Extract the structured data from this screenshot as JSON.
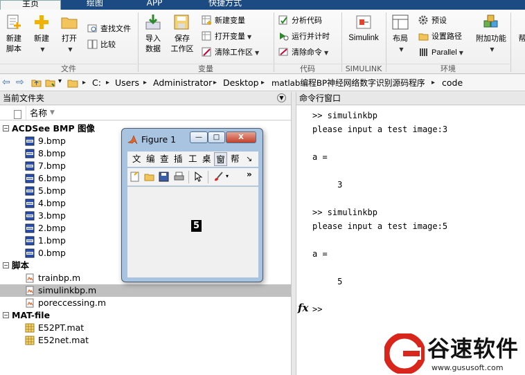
{
  "ribbon_tabs": [
    {
      "label": "主页",
      "active": true
    },
    {
      "label": "绘图",
      "active": false
    },
    {
      "label": "APP",
      "active": false
    },
    {
      "label": "快捷方式",
      "active": false
    }
  ],
  "ribbon": {
    "file_group": {
      "label": "文件",
      "new_script": "新建\n脚本",
      "new": "新建",
      "open": "打开",
      "find_files": "查找文件",
      "compare": "比较"
    },
    "variable_group": {
      "label": "变量",
      "import_data": "导入\n数据",
      "save_workspace": "保存\n工作区",
      "new_variable": "新建变量",
      "open_variable": "打开变量",
      "clear_workspace": "清除工作区"
    },
    "code_group": {
      "label": "代码",
      "analyze_code": "分析代码",
      "run_and_time": "运行并计时",
      "clear_commands": "清除命令"
    },
    "simulink_group": {
      "label": "SIMULINK",
      "simulink": "Simulink"
    },
    "environment_group": {
      "label": "环境",
      "layout": "布局",
      "preferences": "预设",
      "set_path": "设置路径",
      "parallel": "Parallel",
      "add_ons": "附加功能",
      "help_partial": "帮"
    }
  },
  "address": {
    "crumbs": [
      "C:",
      "Users",
      "Administrator",
      "Desktop",
      "matlab编程BP神经网络数字识别源码程序",
      "code"
    ]
  },
  "current_folder": {
    "title": "当前文件夹",
    "name_header": "名称",
    "groups": [
      {
        "label": "ACDSee BMP 图像",
        "items": [
          "9.bmp",
          "8.bmp",
          "7.bmp",
          "6.bmp",
          "5.bmp",
          "4.bmp",
          "3.bmp",
          "2.bmp",
          "1.bmp",
          "0.bmp"
        ]
      },
      {
        "label": "脚本",
        "items": [
          "trainbp.m",
          "simulinkbp.m",
          "poreccessing.m"
        ]
      },
      {
        "label": "MAT-file",
        "items": [
          "E52PT.mat",
          "E52net.mat"
        ]
      }
    ],
    "selected": "simulinkbp.m"
  },
  "command_window": {
    "title": "命令行窗口",
    "lines": [
      ">> simulinkbp",
      "please input a test image:3",
      "",
      "a =",
      "",
      "     3",
      "",
      ">> simulinkbp",
      "please input a test image:5",
      "",
      "a =",
      "",
      "     5",
      "",
      ">>"
    ],
    "fx": "fx"
  },
  "figure": {
    "title": "Figure 1",
    "menu": [
      "文",
      "编",
      "查",
      "插",
      "工",
      "桌",
      "窗",
      "帮",
      "↘"
    ],
    "shown_digit": "5",
    "buttons": {
      "minimize": "—",
      "maximize": "□",
      "close": "X"
    }
  },
  "watermark": {
    "brand": "谷速软件",
    "url": "www.gususoft.com"
  },
  "colors": {
    "tab_bar": "#1c4a83",
    "selected_row": "#c0c0c0",
    "figure_frame": "#a9c4e0",
    "watermark_red": "#d9261c"
  }
}
